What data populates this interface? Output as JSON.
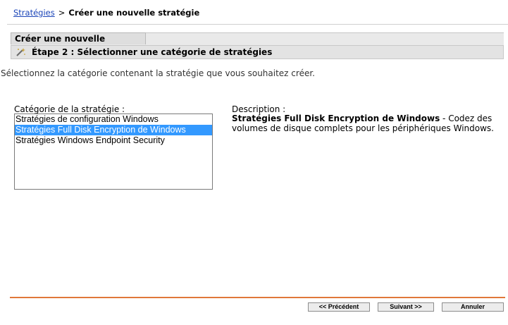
{
  "breadcrumb": {
    "link": "Stratégies",
    "separator": ">",
    "current": "Créer une nouvelle stratégie"
  },
  "wizard": {
    "title": "Créer une nouvelle stratégie",
    "step_label": "Étape 2 : Sélectionner une catégorie de stratégies",
    "step_icon": "wand-icon",
    "instruction": "Sélectionnez la catégorie contenant la stratégie que vous souhaitez créer."
  },
  "category": {
    "label": "Catégorie de la stratégie :",
    "options": [
      "Stratégies de configuration Windows",
      "Stratégies Full Disk Encryption de Windows",
      "Stratégies Windows Endpoint Security"
    ],
    "selected": "Stratégies Full Disk Encryption de Windows",
    "selected_color": "#3399ff"
  },
  "description": {
    "label": "Description :",
    "name": "Stratégies Full Disk Encryption de Windows",
    "separator": " - ",
    "text": "Codez des volumes de disque complets pour les périphériques Windows."
  },
  "footer": {
    "previous_label": "<< Précédent",
    "next_label": "Suivant >>",
    "cancel_label": "Annuler",
    "rule_color": "#e0783a"
  }
}
